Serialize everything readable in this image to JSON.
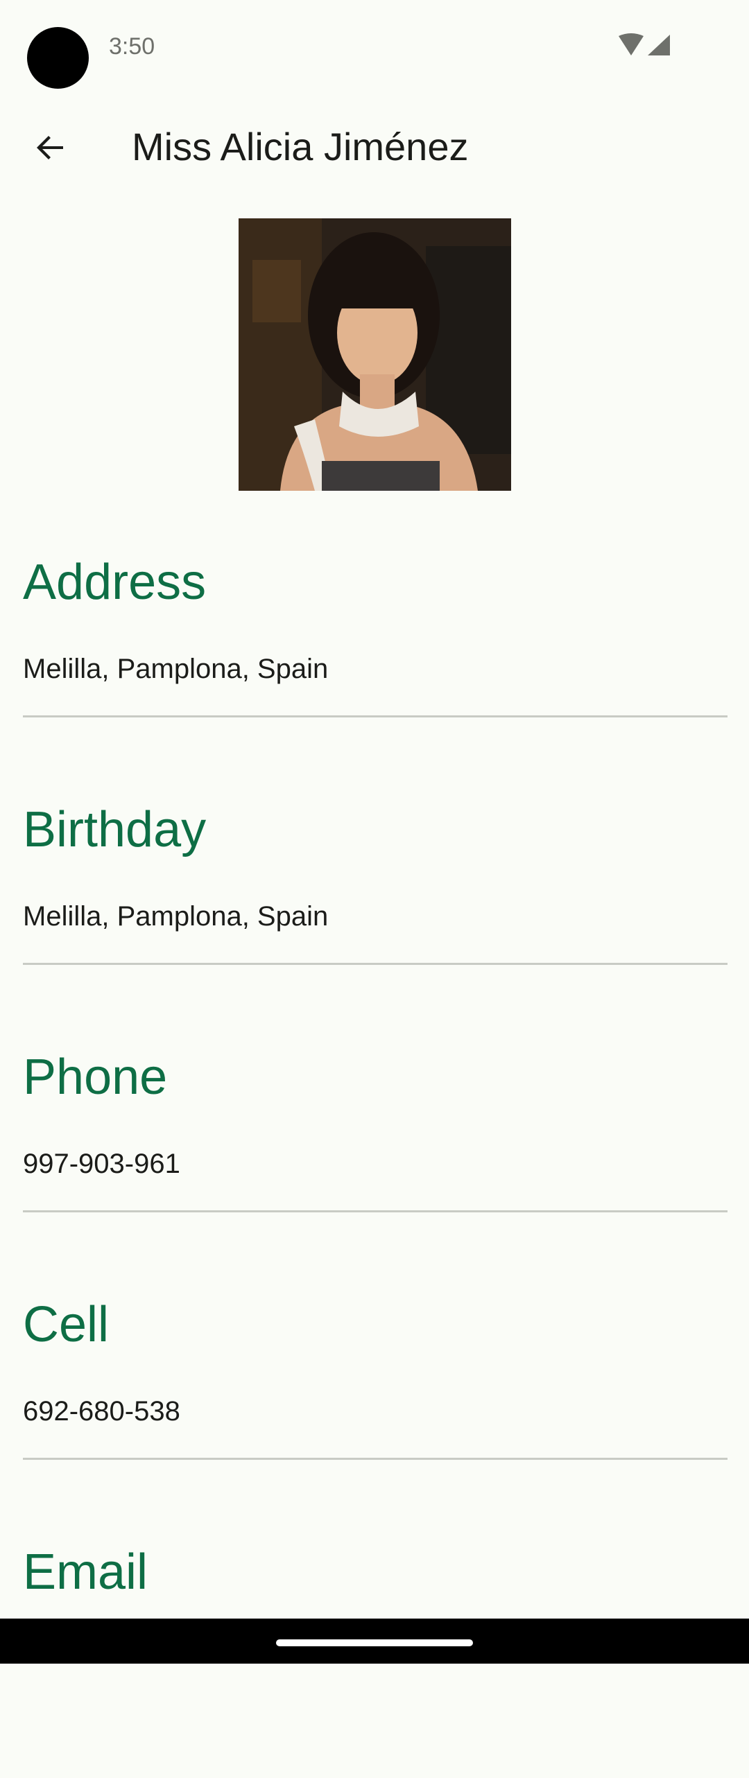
{
  "status_bar": {
    "time": "3:50",
    "icons": [
      "wifi-icon",
      "cell-signal-icon"
    ]
  },
  "app_bar": {
    "back_icon": "arrow-back-icon",
    "title": "Miss Alicia Jiménez"
  },
  "profile": {
    "photo": "profile-photo"
  },
  "fields": [
    {
      "label": "Address",
      "value": "Melilla, Pamplona, Spain"
    },
    {
      "label": "Birthday",
      "value": "Melilla, Pamplona, Spain"
    },
    {
      "label": "Phone",
      "value": "997-903-961"
    },
    {
      "label": "Cell",
      "value": "692-680-538"
    },
    {
      "label": "Email",
      "value": ""
    }
  ],
  "colors": {
    "background": "#fafcf7",
    "accent": "#0e6e45",
    "text": "#1b1c19",
    "divider": "#c8cbc4"
  }
}
